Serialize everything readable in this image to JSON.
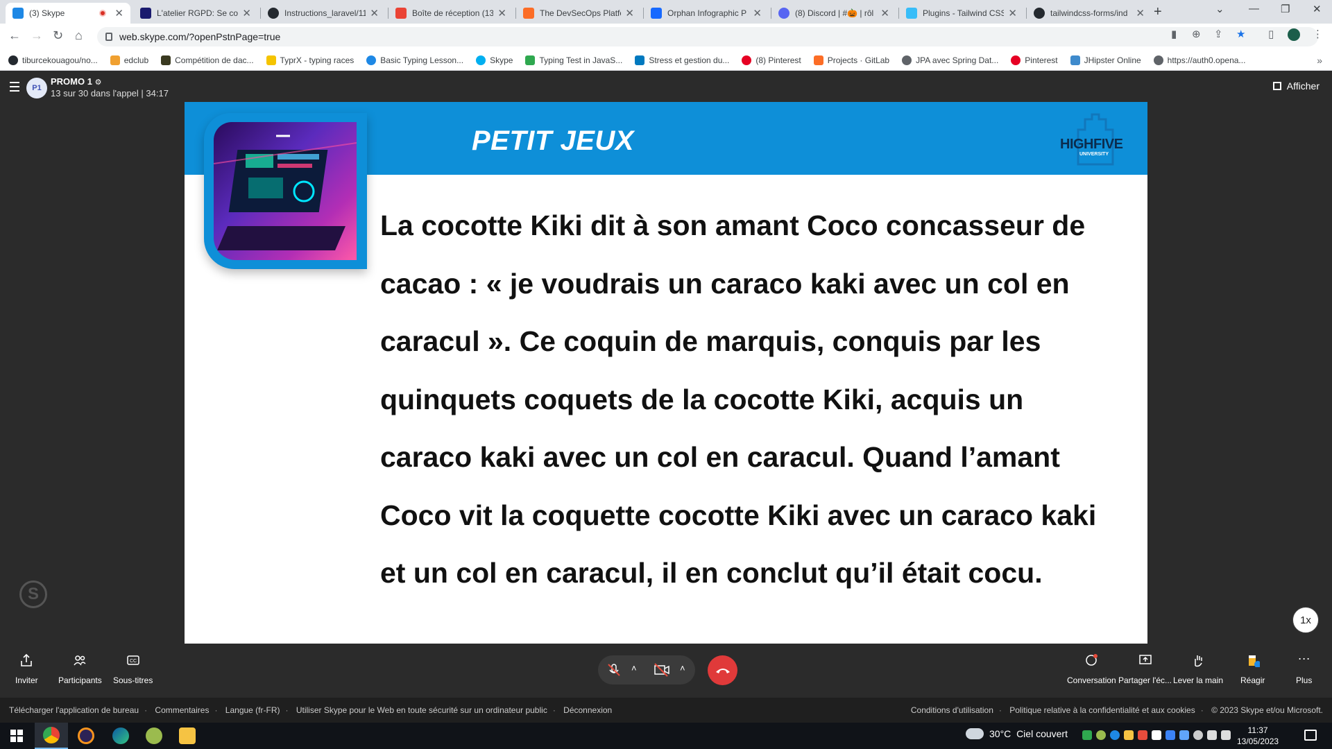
{
  "browser": {
    "tabs": [
      {
        "title": "(3) Skype",
        "color": "#1e88e5",
        "active": true,
        "recording": true
      },
      {
        "title": "L'atelier RGPD: Se con",
        "color": "#1a1a6e"
      },
      {
        "title": "Instructions_laravel/11",
        "color": "#24292f"
      },
      {
        "title": "Boîte de réception (13",
        "color": "#ea4335"
      },
      {
        "title": "The DevSecOps Platfo",
        "color": "#fc6d26"
      },
      {
        "title": "Orphan Infographic P",
        "color": "#1769ff"
      },
      {
        "title": "(8) Discord | #🎃 | rôl",
        "color": "#5865f2"
      },
      {
        "title": "Plugins - Tailwind CSS",
        "color": "#38bdf8"
      },
      {
        "title": "tailwindcss-forms/ind",
        "color": "#24292f"
      }
    ],
    "url": "web.skype.com/?openPstnPage=true",
    "bookmarks": [
      {
        "label": "tiburcekouagou/no...",
        "color": "#24292f"
      },
      {
        "label": "edclub",
        "color": "#f0a030"
      },
      {
        "label": "Compétition de dac...",
        "color": "#3a3a20"
      },
      {
        "label": "TyprX - typing races",
        "color": "#f5c400"
      },
      {
        "label": "Basic Typing Lesson...",
        "color": "#1e88e5"
      },
      {
        "label": "Skype",
        "color": "#00aff0"
      },
      {
        "label": "Typing Test in JavaS...",
        "color": "#2fa84f"
      },
      {
        "label": "Stress et gestion du...",
        "color": "#0079bf"
      },
      {
        "label": "(8) Pinterest",
        "color": "#e60023"
      },
      {
        "label": "Projects · GitLab",
        "color": "#fc6d26"
      },
      {
        "label": "JPA avec Spring Dat...",
        "color": "#5f6368"
      },
      {
        "label": "Pinterest",
        "color": "#e60023"
      },
      {
        "label": "JHipster Online",
        "color": "#3e8acc"
      },
      {
        "label": "https://auth0.opena...",
        "color": "#5f6368"
      }
    ]
  },
  "call": {
    "avatar_initials": "P1",
    "group_name": "PROMO 1",
    "status": "13 sur 30 dans l'appel | 34:17",
    "show_label": "Afficher",
    "speed": "1x"
  },
  "slide": {
    "title": "PETIT JEUX",
    "logo_text": "HIGHFIVE",
    "logo_sub": "UNIVERSITY",
    "body": "La cocotte Kiki dit à son amant Coco concasseur de cacao : « je voudrais un caraco kaki avec un col en caracul ». Ce coquin de marquis, conquis par les quinquets coquets de la cocotte Kiki, acquis un caraco kaki avec un col en caracul. Quand l’amant Coco vit la coquette cocotte Kiki avec un caraco kaki et un col en caracul, il en conclut qu’il était cocu.",
    "banner_color": "#0e8fd8"
  },
  "controls": {
    "invite": "Inviter",
    "participants": "Participants",
    "subtitles": "Sous-titres",
    "conversation": "Conversation",
    "share": "Partager l'éc...",
    "raise_hand": "Lever la main",
    "react": "Réagir",
    "more": "Plus"
  },
  "footer": {
    "left": [
      "Télécharger l'application de bureau",
      "Commentaires",
      "Langue (fr-FR)",
      "Utiliser Skype pour le Web en toute sécurité sur un ordinateur public",
      "Déconnexion"
    ],
    "right": [
      "Conditions d'utilisation",
      "Politique relative à la confidentialité et aux cookies",
      "© 2023 Skype et/ou Microsoft."
    ]
  },
  "taskbar": {
    "weather_temp": "30°C",
    "weather_desc": "Ciel couvert",
    "time": "11:37",
    "date": "13/05/2023"
  }
}
